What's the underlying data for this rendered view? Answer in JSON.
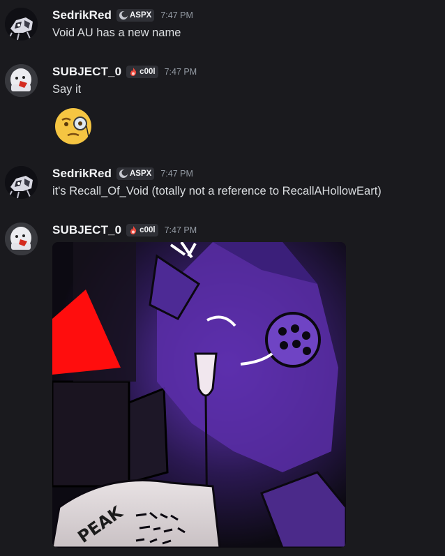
{
  "messages": [
    {
      "username": "SedrikRed",
      "tag": "ASPX",
      "time": "7:47 PM",
      "text": "Void AU has a new name"
    },
    {
      "username": "SUBJECT_0",
      "tag": "c00l",
      "time": "7:47 PM",
      "text": "Say it",
      "emoji": "face-with-monocle"
    },
    {
      "username": "SedrikRed",
      "tag": "ASPX",
      "time": "7:47 PM",
      "text": "it's Recall_Of_Void (totally not a reference to RecallAHollowEart)"
    },
    {
      "username": "SUBJECT_0",
      "tag": "c00l",
      "time": "7:47 PM",
      "attachment_text": "PEAK"
    }
  ]
}
